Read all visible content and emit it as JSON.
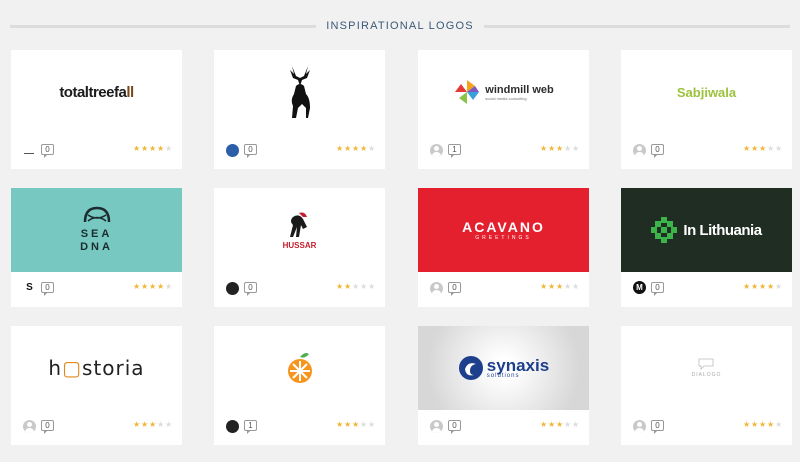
{
  "section": {
    "title": "INSPIRATIONAL LOGOS"
  },
  "cards": [
    {
      "logo_text": "totaltreefa",
      "logo_accent": "ll",
      "comments": "0",
      "rating": 3.5
    },
    {
      "logo_text": "",
      "comments": "0",
      "rating": 4
    },
    {
      "logo_text": "windmill web",
      "logo_sub": "social media consulting",
      "comments": "1",
      "rating": 3
    },
    {
      "logo_text": "Sabjiwala",
      "comments": "0",
      "rating": 2.5
    },
    {
      "logo_text_1": "SEA",
      "logo_text_2": "DNA",
      "avatar_letter": "S",
      "comments": "0",
      "rating": 3.5
    },
    {
      "logo_text": "HUSSAR",
      "comments": "0",
      "rating": 2
    },
    {
      "logo_text": "ACAVANO",
      "logo_sub": "GREETINGS",
      "comments": "0",
      "rating": 2.5
    },
    {
      "logo_text": "In Lithuania",
      "avatar_letter": "M",
      "comments": "0",
      "rating": 4
    },
    {
      "logo_text_1": "h",
      "logo_text_2": "storia",
      "comments": "0",
      "rating": 2.5
    },
    {
      "logo_text": "",
      "comments": "1",
      "rating": 3
    },
    {
      "logo_text": "synaxis",
      "logo_sub": "solutions",
      "comments": "0",
      "rating": 2.5
    },
    {
      "logo_text": "DIALOGO",
      "comments": "0",
      "rating": 4
    }
  ],
  "colors": {
    "header_text": "#3b5876",
    "star_on": "#f2b63a",
    "star_off": "#dddddd"
  }
}
